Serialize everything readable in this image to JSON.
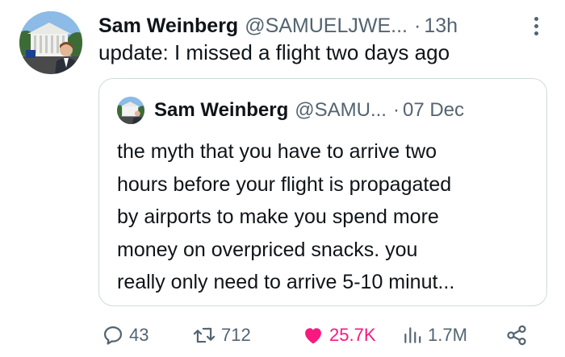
{
  "tweet": {
    "author_name": "Sam Weinberg",
    "author_handle": "@SAMUELJWE...",
    "separator": "·",
    "time": "13h",
    "text": "update: I missed a flight two days ago"
  },
  "quoted_tweet": {
    "author_name": "Sam Weinberg",
    "author_handle": "@SAMU...",
    "separator": "·",
    "date": "07 Dec",
    "lines": [
      "the myth that you have to arrive two",
      "hours before your flight is propagated",
      "by airports to make you spend more",
      "money on overpriced snacks. you",
      "really only need to arrive 5-10 minut..."
    ]
  },
  "actions": {
    "replies": "43",
    "retweets": "712",
    "likes": "25.7K",
    "views": "1.7M"
  },
  "icons": {
    "reply": "speech-bubble-icon",
    "retweet": "retweet-arrows-icon",
    "like": "heart-icon",
    "views": "bar-chart-icon",
    "share": "share-nodes-icon",
    "more": "vertical-dots-icon"
  },
  "colors": {
    "like_active": "#f91880",
    "muted_text": "#536471",
    "border": "#cfd9de"
  }
}
